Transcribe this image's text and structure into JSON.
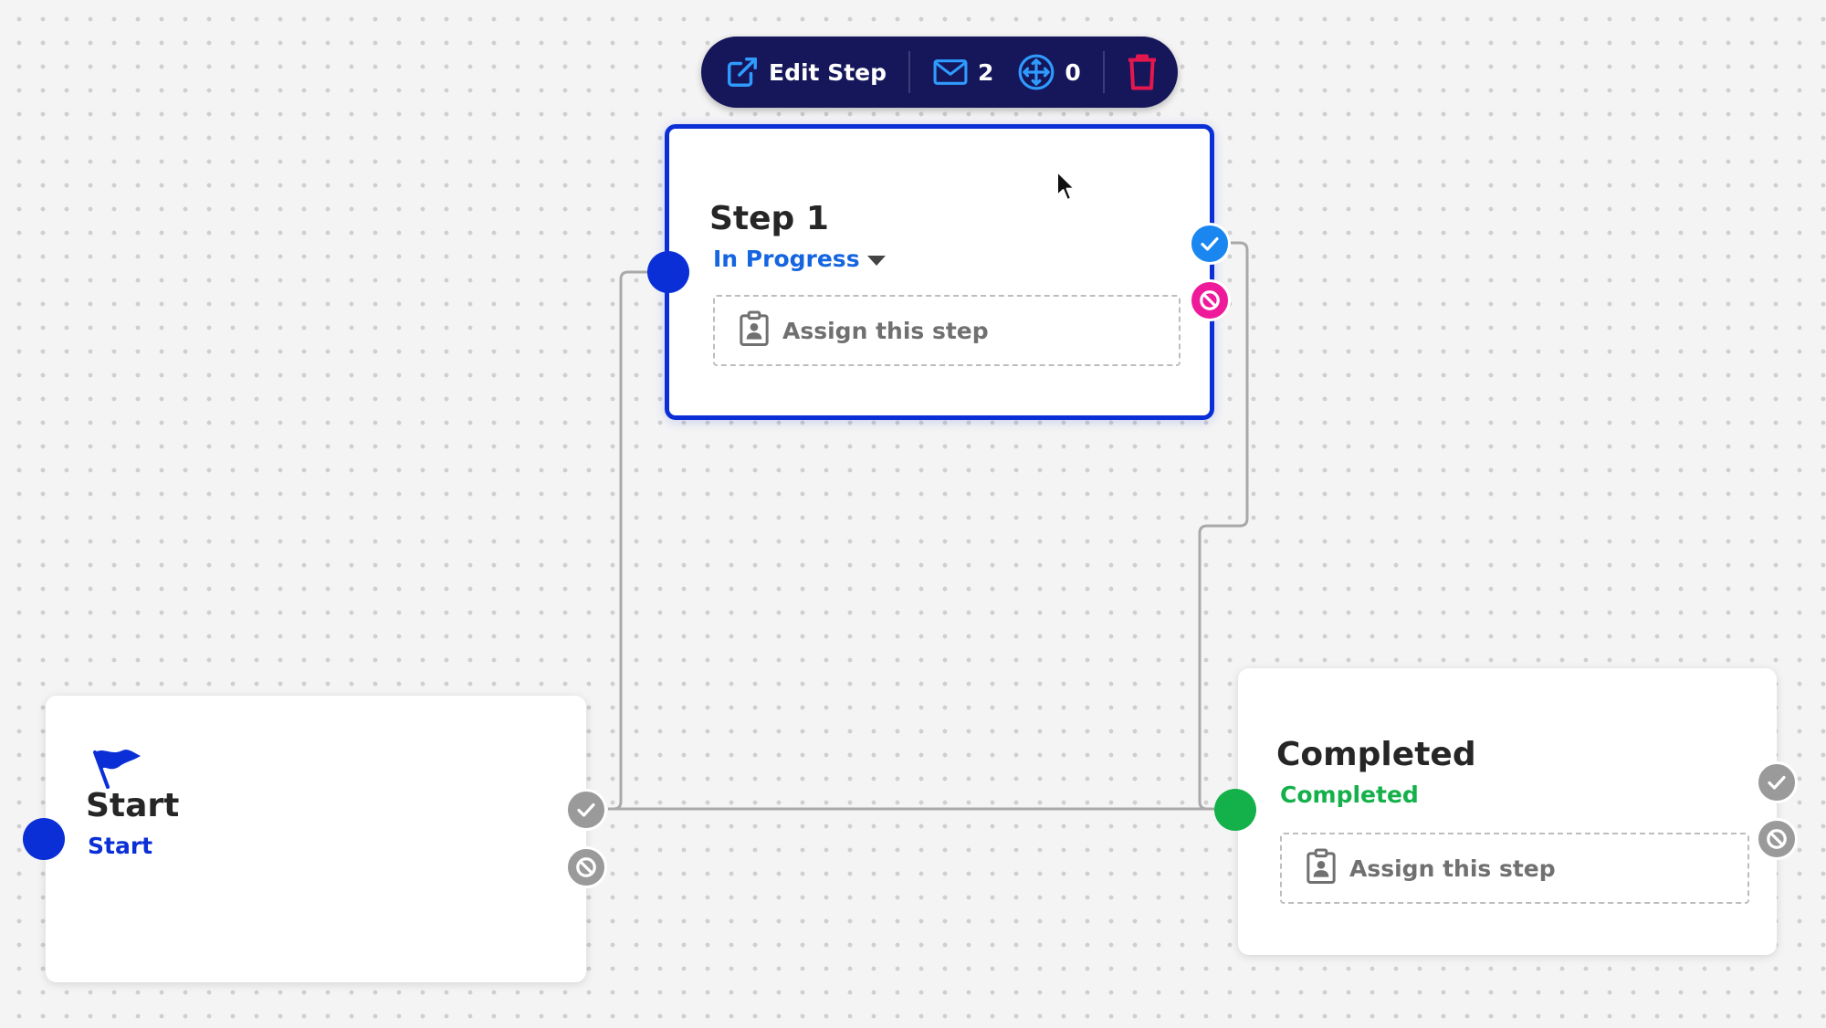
{
  "toolbar": {
    "edit_label": "Edit Step",
    "email_count": "2",
    "connector_count": "0"
  },
  "icons": {
    "edit": "external-link-icon",
    "email": "envelope-icon",
    "connector": "arrows-move-icon",
    "delete": "trash-icon",
    "flag": "flag-icon",
    "assign": "clipboard-user-icon",
    "approve": "check-icon",
    "reject": "ban-icon"
  },
  "nodes": {
    "step1": {
      "title": "Step 1",
      "status": "In Progress",
      "assign_label": "Assign this step"
    },
    "start": {
      "title": "Start",
      "status": "Start"
    },
    "completed": {
      "title": "Completed",
      "status": "Completed",
      "assign_label": "Assign this step"
    }
  },
  "colors": {
    "toolbar_bg": "#15175a",
    "accent_blue": "#0a2fd6",
    "status_blue": "#1565e0",
    "status_green": "#14b04a",
    "reject_pink": "#ef1a9a",
    "delete_red": "#e5174f",
    "handle_gray": "#9a9a9a"
  }
}
